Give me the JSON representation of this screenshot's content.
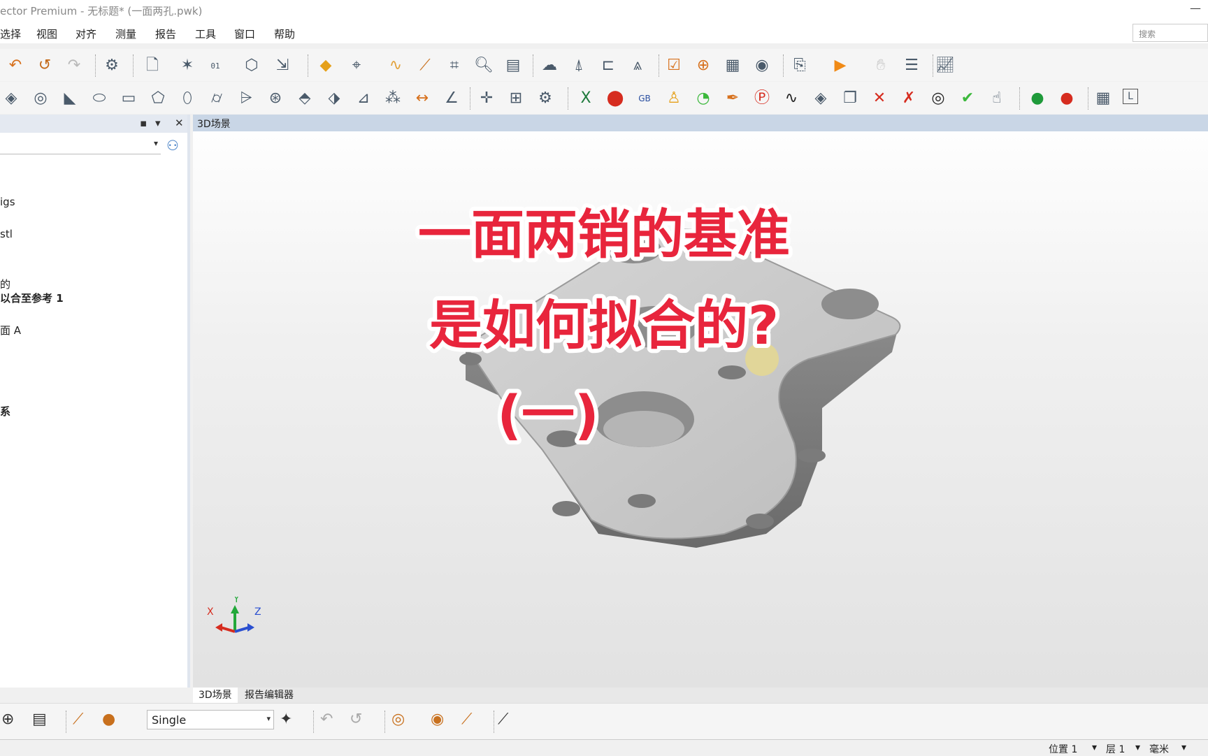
{
  "window": {
    "title": "ector Premium - 无标题* (一面两孔.pwk)",
    "minimize_glyph": "—"
  },
  "menu": [
    "选择",
    "视图",
    "对齐",
    "测量",
    "报告",
    "工具",
    "窗口",
    "帮助"
  ],
  "search": {
    "placeholder": "搜索"
  },
  "toolbar1_icons": [
    "undo-icon",
    "undo-history-icon",
    "redo-icon",
    "settings-icon",
    "new-document-icon",
    "scatter-icon",
    "binary-icon",
    "pointcloud-icon",
    "align-icon",
    "color-map-icon",
    "measure-icon",
    "curve-icon",
    "probe-icon",
    "probe-path-icon",
    "magnify-icon",
    "report-icon",
    "surface-icon",
    "gauge-icon",
    "caliper-icon",
    "compass-icon",
    "checklist-icon",
    "snapshot-icon",
    "table-icon",
    "camera-icon",
    "import-icon",
    "play-icon",
    "hand-icon",
    "list-icon",
    "graph-icon"
  ],
  "toolbar2_icons": [
    "plane-icon",
    "circle-icon",
    "cone-icon",
    "slot-icon",
    "rect-icon",
    "polygon-icon",
    "ellipse-icon",
    "cylinder-icon",
    "cone3d-icon",
    "sphere-icon",
    "freeform-icon",
    "box-icon",
    "angle-line-icon",
    "pins-icon",
    "distance-icon",
    "angle-icon",
    "crosshair-icon",
    "grid-icon",
    "gear-icon",
    "excel-icon",
    "delete-icon",
    "gb-icon",
    "person-icon",
    "clock-icon",
    "pen-icon",
    "p-icon",
    "pulse-icon",
    "layers-icon",
    "cubes-icon",
    "explode-icon",
    "target-x-icon",
    "hide-icon",
    "check-icon",
    "touch-icon",
    "record-green-icon",
    "record-red-icon",
    "table2-icon",
    "l-icon"
  ],
  "panel": {
    "pin": "▪",
    "dropdown": "▾",
    "close": "✕",
    "combo_arrow": "▾"
  },
  "tree": [
    {
      "text": "igs",
      "bold": false
    },
    {
      "text": "stl",
      "bold": false
    },
    {
      "text": "的",
      "bold": false
    },
    {
      "text": "以合至参考 1",
      "bold": true
    },
    {
      "text": "面 A",
      "bold": false
    },
    {
      "text": "系",
      "bold": true
    }
  ],
  "viewport": {
    "tab_title": "3D场景",
    "overlay_line1": "一面两销的基准",
    "overlay_line2": "是如何拟合的?",
    "overlay_line3": "(一)",
    "axis_x": "X",
    "axis_y": "Y",
    "axis_z": "Z",
    "overlay_color": "#e8253c"
  },
  "view_tabs": [
    "3D场景",
    "报告编辑器"
  ],
  "bottom": {
    "select_value": "Single",
    "select_arrow": "▾"
  },
  "status": {
    "position": "位置 1",
    "layer": "层 1",
    "unit": "毫米",
    "arrow": "▾"
  }
}
